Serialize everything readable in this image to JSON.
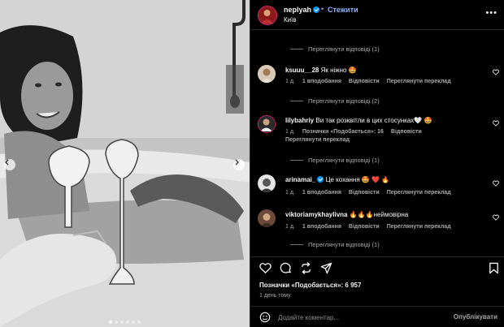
{
  "post": {
    "carousel": {
      "slide_count": 6,
      "active_index": 0
    }
  },
  "header": {
    "username": "neplyah",
    "separator": "•",
    "follow_label": "Стежити",
    "location": "Київ",
    "more_label": "•••"
  },
  "comments": {
    "view_replies": [
      {
        "label": "Переглянути відповіді (1)"
      },
      {
        "label": "Переглянути відповіді (2)"
      },
      {
        "label": "Переглянути відповіді (1)"
      },
      {
        "label": "Переглянути відповіді (1)"
      },
      {
        "label": "Переглянути відповіді (1)"
      }
    ],
    "items": [
      {
        "username": "ksuuu__28",
        "text": "Як ніжно 🤩",
        "meta": {
          "time": "1 д.",
          "likes": "1 вподобання",
          "reply": "Відповісти",
          "translate": "Переглянути переклад"
        }
      },
      {
        "username": "lilybahriy",
        "text": "Ви так розквітли в цих стосунках🤍 🤩",
        "meta": {
          "time": "1 д.",
          "likes": "Позначки «Подобається»: 16",
          "reply": "Відповісти",
          "translate": "Переглянути переклад"
        }
      },
      {
        "username": "arinamai_",
        "text": "Це кохання 🤩 ❤️ 🔥",
        "meta": {
          "time": "1 д.",
          "likes": "1 вподобання",
          "reply": "Відповісти",
          "translate": "Переглянути переклад"
        }
      },
      {
        "username": "viktoriamykhaylivna",
        "text": "🔥🔥🔥неймовірна",
        "meta": {
          "time": "1 д.",
          "likes": "1 вподобання",
          "reply": "Відповісти",
          "translate": "Переглянути переклад"
        }
      }
    ]
  },
  "actions": {
    "likes_text": "Позначки «Подобається»: 6 957",
    "date": "1 день тому"
  },
  "add_comment": {
    "placeholder": "Додайте коментар...",
    "publish_label": "Опублікувати"
  },
  "colors": {
    "background": "#000000",
    "text_primary": "#f5f5f5",
    "text_secondary": "#a8a8a8",
    "link_blue": "#8ab4f8",
    "verified": "#0095f6",
    "divider": "#262626"
  },
  "icons": [
    "chevron-left-icon",
    "chevron-right-icon",
    "verified-badge-icon",
    "more-icon",
    "heart-icon",
    "comment-icon",
    "share-icon",
    "send-icon",
    "bookmark-icon",
    "emoji-icon"
  ]
}
